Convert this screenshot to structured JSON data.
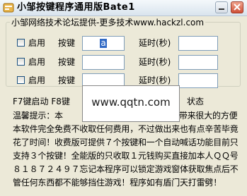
{
  "window": {
    "title": "小邹按键程序通用版Bate1"
  },
  "group": {
    "label": "小邹网络技术论坛提供-更多技术www.hackzl.com"
  },
  "rows": [
    {
      "enable_label": "启用",
      "key_label": "按键",
      "key_value": "a",
      "delay_label": "延时(秒)",
      "delay_value": ""
    },
    {
      "enable_label": "启用",
      "key_label": "按键",
      "key_value": "",
      "delay_label": "延时(秒)",
      "delay_value": ""
    },
    {
      "enable_label": "启用",
      "key_label": "按键",
      "key_value": "",
      "delay_label": "延时(秒)",
      "delay_value": ""
    }
  ],
  "hotkeys": {
    "left": "F7键启动  F8键",
    "right": "状态"
  },
  "overlay": {
    "text": "www.qqtn.com"
  },
  "tips": {
    "line1": "温馨提示：本",
    "line1_tail": "带来很大的方便",
    "line2": "本软件完全免费不收取任何费用，不过做出来也有点辛苦毕竟",
    "line3": "花了时间！收费版可提供７个按键和一个自动喊话功能目前只",
    "line4": "支持３个按键！全能版的只收取１元钱购买直接加本人ＱＱ号",
    "line5": "８１８７２４９７忘记本程序可以锁定游戏窗体获取焦点后不",
    "line6": "管任何东西都不能够挡住游戏！程序如有盾门天打雷劈！"
  },
  "colors": {
    "selection": "#316ac5",
    "client_bg": "#ece9d8"
  }
}
